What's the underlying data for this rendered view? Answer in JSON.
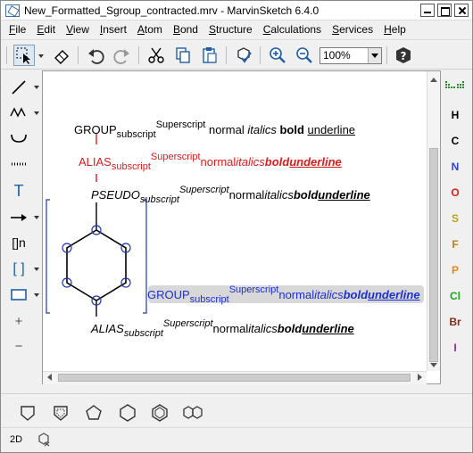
{
  "window": {
    "title": "New_Formatted_Sgroup_contracted.mrv - MarvinSketch 6.4.0"
  },
  "menubar": {
    "items": [
      {
        "key": "F",
        "rest": "ile"
      },
      {
        "key": "E",
        "rest": "dit"
      },
      {
        "key": "V",
        "rest": "iew"
      },
      {
        "key": "I",
        "rest": "nsert"
      },
      {
        "key": "A",
        "rest": "tom"
      },
      {
        "key": "B",
        "rest": "ond"
      },
      {
        "key": "S",
        "rest": "tructure"
      },
      {
        "key": "C",
        "rest": "alculations"
      },
      {
        "key": "S",
        "rest": "ervices"
      },
      {
        "key": "H",
        "rest": "elp"
      }
    ]
  },
  "toolbar": {
    "zoom_value": "100%"
  },
  "canvas": {
    "row1": {
      "group": "GROUP",
      "sub": "subscript",
      "sup": "Superscript",
      "normal": "normal",
      "italics": "italics",
      "bold": "bold",
      "underline": "underline"
    },
    "row2": {
      "group": "ALIAS",
      "sub": "subscript",
      "sup": "Superscript",
      "normal": "normal",
      "italics": "italics",
      "bold": "bold",
      "underline": "underline"
    },
    "row3": {
      "group": "PSEUDO",
      "sub": "subscript",
      "sup": "Superscript",
      "normal": "normal",
      "italics": "italics",
      "bold": "bold",
      "underline": "underline"
    },
    "row4": {
      "group": "GROUP",
      "sub": "subscript",
      "sup": "Superscript",
      "normal": "normal",
      "italics": "italics",
      "bold": "bold",
      "underline": "underline"
    },
    "row5": {
      "group": "ALIAS",
      "sub": "subscript",
      "sup": "Superscript",
      "normal": "normal",
      "italics": "italics",
      "bold": "bold",
      "underline": "underline"
    }
  },
  "lefttoolbar": {
    "text_tool": "T",
    "bracket_label": "[]n",
    "sgroup_bracket": "[ ]",
    "plus": "+",
    "minus": "−"
  },
  "elements": [
    {
      "symbol": "H",
      "color": "#000000"
    },
    {
      "symbol": "C",
      "color": "#000000"
    },
    {
      "symbol": "N",
      "color": "#2f3fd6"
    },
    {
      "symbol": "O",
      "color": "#e01b1b"
    },
    {
      "symbol": "S",
      "color": "#b9a21a"
    },
    {
      "symbol": "F",
      "color": "#c08018"
    },
    {
      "symbol": "P",
      "color": "#e38a14"
    },
    {
      "symbol": "Cl",
      "color": "#1ea81e"
    },
    {
      "symbol": "Br",
      "color": "#8a2b18"
    },
    {
      "symbol": "I",
      "color": "#8a2aa8"
    }
  ],
  "statusbar": {
    "mode": "2D"
  },
  "colors": {
    "alias_red": "#e01b1b",
    "group_blue": "#1c2fd6",
    "bracket_blue": "#2136b0"
  }
}
